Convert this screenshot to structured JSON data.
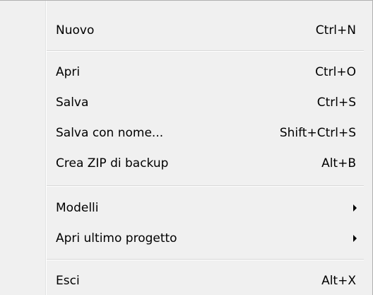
{
  "menu": {
    "items": [
      {
        "label": "Nuovo",
        "shortcut": "Ctrl+N"
      },
      {
        "label": "Apri",
        "shortcut": "Ctrl+O"
      },
      {
        "label": "Salva",
        "shortcut": "Ctrl+S"
      },
      {
        "label": "Salva con nome...",
        "shortcut": "Shift+Ctrl+S"
      },
      {
        "label": "Crea ZIP di backup",
        "shortcut": "Alt+B"
      },
      {
        "label": "Modelli",
        "submenu": true
      },
      {
        "label": "Apri ultimo progetto",
        "submenu": true
      },
      {
        "label": "Esci",
        "shortcut": "Alt+X"
      }
    ]
  },
  "icons": {
    "submenu_arrow": "submenu-arrow-icon"
  },
  "colors": {
    "menu_background": "#f0f0f0",
    "separator": "#d7d7d7",
    "text": "#000000"
  }
}
